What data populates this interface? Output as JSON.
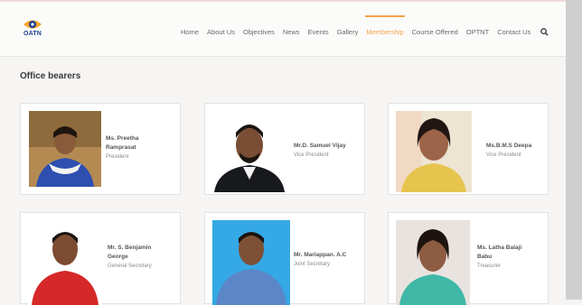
{
  "nav": {
    "logo_text": "OATN",
    "items": [
      "Home",
      "About Us",
      "Objectives",
      "News",
      "Events",
      "Gallery",
      "Membership",
      "Course Offered",
      "OPTNT",
      "Contact Us"
    ],
    "active_index": 6
  },
  "section_title": "Office bearers",
  "members": [
    {
      "name_line1": "Ms. Preetha",
      "name_line2": "Ramprasat",
      "role": "President"
    },
    {
      "name_line1": "Mr.D. Samuel Vijay",
      "name_line2": "",
      "role": "Vice President"
    },
    {
      "name_line1": "Ms.B.M.S Deepa",
      "name_line2": "",
      "role": "Vice President"
    },
    {
      "name_line1": "Mr. S. Benjamin",
      "name_line2": "George",
      "role": "General Secretary"
    },
    {
      "name_line1": "Mr. Mariappan. A.C",
      "name_line2": "",
      "role": "Joint Secretary"
    },
    {
      "name_line1": "Ms. Latha Balaji",
      "name_line2": "Babu",
      "role": "Treasurer"
    }
  ],
  "colors": {
    "accent": "#f2a44a",
    "brand": "#1c3d8f"
  }
}
